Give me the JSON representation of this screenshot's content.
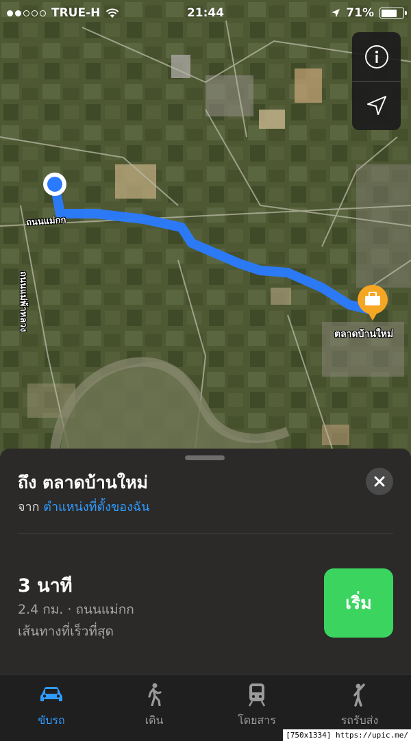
{
  "status_bar": {
    "carrier": "TRUE-H",
    "time": "21:44",
    "battery": "71%",
    "battery_level": 0.71
  },
  "map": {
    "road_label_1": "ถนนแม่กก",
    "road_label_2": "ถนนแม่พ้าหลวง",
    "destination_label": "ตลาดบ้านใหม่",
    "route_color": "#2a7bff"
  },
  "map_controls": {
    "info_icon": "info-icon",
    "location_icon": "location-arrow-icon"
  },
  "card": {
    "title": "ถึง ตลาดบ้านใหม่",
    "from_prefix": "จาก",
    "from_link": "ตำแหน่งที่ตั้งของฉัน",
    "eta": "3 นาที",
    "summary": "2.4 กม. · ถนนแม่กก",
    "note": "เส้นทางที่เร็วที่สุด",
    "go_label": "เริ่ม",
    "accent": "#2f9bff",
    "go_color": "#3ad45f"
  },
  "tabs": [
    {
      "label": "ขับรถ",
      "icon": "car-icon",
      "active": true
    },
    {
      "label": "เดิน",
      "icon": "walking-icon",
      "active": false
    },
    {
      "label": "โดยสาร",
      "icon": "train-icon",
      "active": false
    },
    {
      "label": "รถรับส่ง",
      "icon": "rideshare-icon",
      "active": false
    }
  ],
  "watermark": "[750x1334] https://upic.me/"
}
